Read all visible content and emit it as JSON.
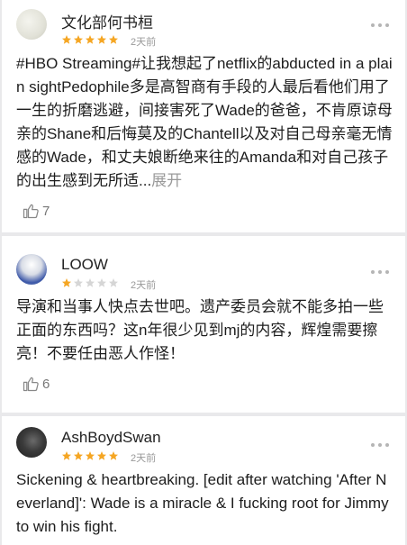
{
  "reviews": [
    {
      "username": "文化部何书桓",
      "rating": 5,
      "time": "2天前",
      "text": "#HBO Streaming#让我想起了netflix的abducted in a plain sightPedophile多是高智商有手段的人最后看他们用了一生的折磨逃避，间接害死了Wade的爸爸，不肯原谅母亲的Shane和后悔莫及的Chantell以及对自己母亲毫无情感的Wade，和丈夫娘断绝来往的Amanda和对自己孩子的出生感到无所适...",
      "expand_label": "展开",
      "likes": "7"
    },
    {
      "username": "LOOW",
      "rating": 1,
      "time": "2天前",
      "text": "导演和当事人快点去世吧。遗产委员会就不能多拍一些正面的东西吗？这n年很少见到mj的内容，辉煌需要擦亮！不要任由恶人作怪！",
      "likes": "6"
    },
    {
      "username": "AshBoydSwan",
      "rating": 5,
      "time": "2天前",
      "text": "Sickening & heartbreaking. [edit after watching 'After Neverland]': Wade is a miracle & I fucking root for Jimmy to win his fight."
    }
  ],
  "colors": {
    "star_on": "#f5a623",
    "star_off": "#d6d6d6",
    "page_bg": "#e9e9eb"
  },
  "icons": {
    "more": "more-dots-icon",
    "like": "thumbs-up-icon"
  }
}
